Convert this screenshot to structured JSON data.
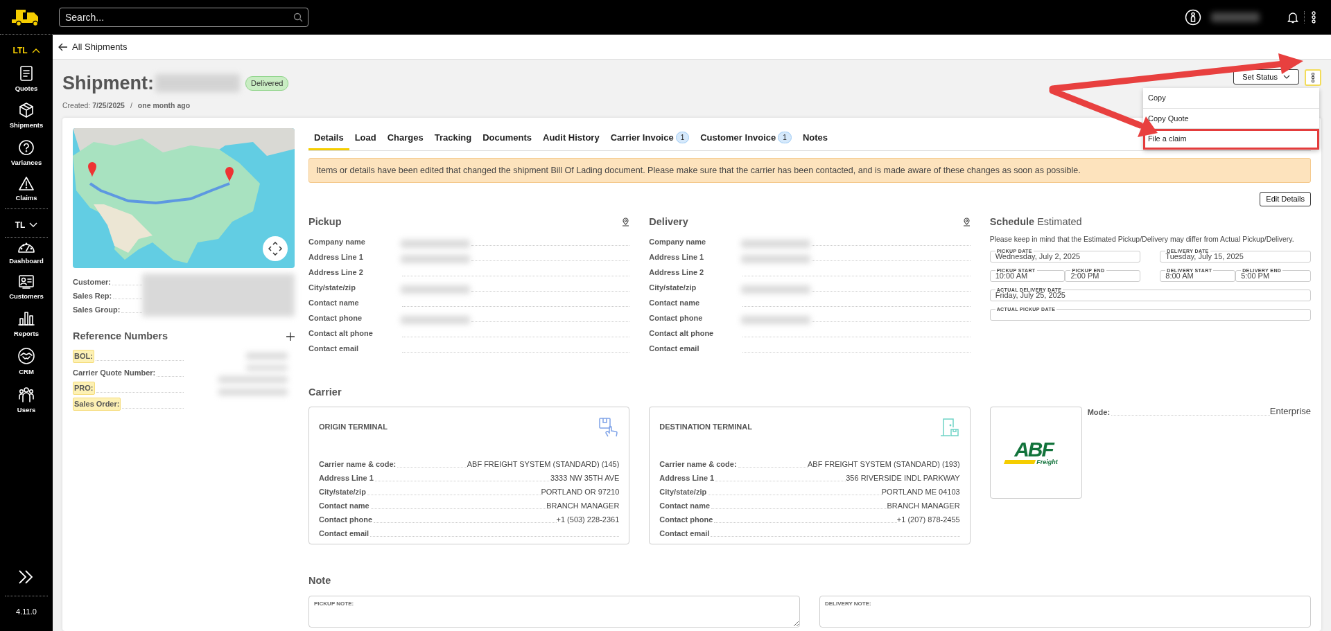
{
  "topbar": {
    "search": {
      "placeholder": "Search..."
    }
  },
  "sidebar": {
    "sections": [
      {
        "label": "LTL",
        "expanded": true,
        "items": [
          {
            "label": "Quotes"
          },
          {
            "label": "Shipments"
          },
          {
            "label": "Variances"
          },
          {
            "label": "Claims"
          }
        ]
      },
      {
        "label": "TL",
        "expanded": false
      }
    ],
    "items": [
      {
        "label": "Dashboard"
      },
      {
        "label": "Customers"
      },
      {
        "label": "Reports"
      },
      {
        "label": "CRM"
      },
      {
        "label": "Users"
      }
    ],
    "version": "4.11.0"
  },
  "breadcrumb": {
    "back_label": "All Shipments"
  },
  "header": {
    "title": "Shipment:",
    "status": "Delivered",
    "created_label": "Created:",
    "created_date": "7/25/2025",
    "separator": "/",
    "age": "one month ago",
    "set_status": "Set Status"
  },
  "menu": {
    "items": [
      {
        "label": "Copy",
        "outlined": false
      },
      {
        "label": "Copy Quote",
        "outlined": false
      },
      {
        "label": "File a claim",
        "outlined": true
      }
    ]
  },
  "summary": [
    {
      "label": "Customer:"
    },
    {
      "label": "Sales Rep:"
    },
    {
      "label": "Sales Group:"
    }
  ],
  "reference_numbers": {
    "title": "Reference Numbers",
    "rows": [
      {
        "label": "BOL:",
        "highlighted": true
      },
      {
        "label": "Carrier Quote Number:",
        "highlighted": false
      },
      {
        "label": "PRO:",
        "highlighted": true
      },
      {
        "label": "Sales Order:",
        "highlighted": true
      }
    ]
  },
  "tabs": [
    {
      "label": "Details",
      "selected": true
    },
    {
      "label": "Load",
      "selected": false
    },
    {
      "label": "Charges",
      "selected": false
    },
    {
      "label": "Tracking",
      "selected": false
    },
    {
      "label": "Documents",
      "selected": false
    },
    {
      "label": "Audit History",
      "selected": false
    },
    {
      "label": "Carrier Invoice",
      "badge": "1",
      "selected": false
    },
    {
      "label": "Customer Invoice",
      "badge": "1",
      "selected": false
    },
    {
      "label": "Notes",
      "selected": false
    }
  ],
  "alert": "Items or details have been edited that changed the shipment Bill Of Lading document. Please make sure that the carrier has been contacted, and is made aware of these changes as soon as possible.",
  "edit_button": "Edit Details",
  "stops": [
    {
      "title": "Pickup",
      "fields": [
        {
          "label": "Company name",
          "redacted": true
        },
        {
          "label": "Address Line 1",
          "redacted": true
        },
        {
          "label": "Address Line 2",
          "redacted": false
        },
        {
          "label": "City/state/zip",
          "redacted": true
        },
        {
          "label": "Contact name",
          "redacted": false
        },
        {
          "label": "Contact phone",
          "redacted": true
        },
        {
          "label": "Contact alt phone",
          "redacted": false
        },
        {
          "label": "Contact email",
          "redacted": false
        }
      ]
    },
    {
      "title": "Delivery",
      "fields": [
        {
          "label": "Company name",
          "redacted": true
        },
        {
          "label": "Address Line 1",
          "redacted": true
        },
        {
          "label": "Address Line 2",
          "redacted": false
        },
        {
          "label": "City/state/zip",
          "redacted": true
        },
        {
          "label": "Contact name",
          "redacted": false
        },
        {
          "label": "Contact phone",
          "redacted": true
        },
        {
          "label": "Contact alt phone",
          "redacted": false
        },
        {
          "label": "Contact email",
          "redacted": false
        }
      ]
    }
  ],
  "schedule": {
    "title": "Schedule",
    "subtitle": "Estimated",
    "note": "Please keep in mind that the Estimated Pickup/Delivery may differ from Actual Pickup/Delivery.",
    "dates": [
      {
        "label": "PICKUP DATE",
        "value": "Wednesday, July 2, 2025"
      },
      {
        "label": "DELIVERY DATE",
        "value": "Tuesday, July 15, 2025"
      }
    ],
    "times": [
      [
        {
          "label": "PICKUP START",
          "value": "10:00 AM"
        },
        {
          "label": "PICKUP END",
          "value": "2:00 PM"
        }
      ],
      [
        {
          "label": "DELIVERY START",
          "value": "8:00 AM"
        },
        {
          "label": "DELIVERY END",
          "value": "5:00 PM"
        }
      ]
    ],
    "actual": [
      {
        "label": "ACTUAL DELIVERY DATE",
        "value": "Friday, July 25, 2025"
      },
      {
        "label": "ACTUAL PICKUP DATE"
      }
    ]
  },
  "carrier": {
    "title": "Carrier",
    "terminals": [
      {
        "title": "ORIGIN TERMINAL",
        "kind": "origin",
        "fields": [
          {
            "label": "Carrier name & code:",
            "value": "ABF FREIGHT SYSTEM (STANDARD) (145)"
          },
          {
            "label": "Address Line 1",
            "value": "3333 NW 35TH AVE"
          },
          {
            "label": "City/state/zip",
            "value": "PORTLAND OR 97210"
          },
          {
            "label": "Contact name",
            "value": "BRANCH MANAGER"
          },
          {
            "label": "Contact phone",
            "value": "+1 (503) 228-2361"
          },
          {
            "label": "Contact email"
          }
        ]
      },
      {
        "title": "DESTINATION TERMINAL",
        "kind": "destination",
        "fields": [
          {
            "label": "Carrier name & code:",
            "value": "ABF FREIGHT SYSTEM (STANDARD) (193)"
          },
          {
            "label": "Address Line 1",
            "value": "356 RIVERSIDE INDL PARKWAY"
          },
          {
            "label": "City/state/zip",
            "value": "PORTLAND ME 04103"
          },
          {
            "label": "Contact name",
            "value": "BRANCH MANAGER"
          },
          {
            "label": "Contact phone",
            "value": "+1 (207) 878-2455"
          },
          {
            "label": "Contact email"
          }
        ]
      }
    ],
    "logo": {
      "name": "ABF",
      "tagline": "Freight"
    },
    "mode": {
      "label": "Mode:",
      "value": "Enterprise"
    }
  },
  "note": {
    "title": "Note",
    "fields": [
      {
        "label": "PICKUP NOTE:"
      },
      {
        "label": "DELIVERY NOTE:"
      }
    ]
  }
}
